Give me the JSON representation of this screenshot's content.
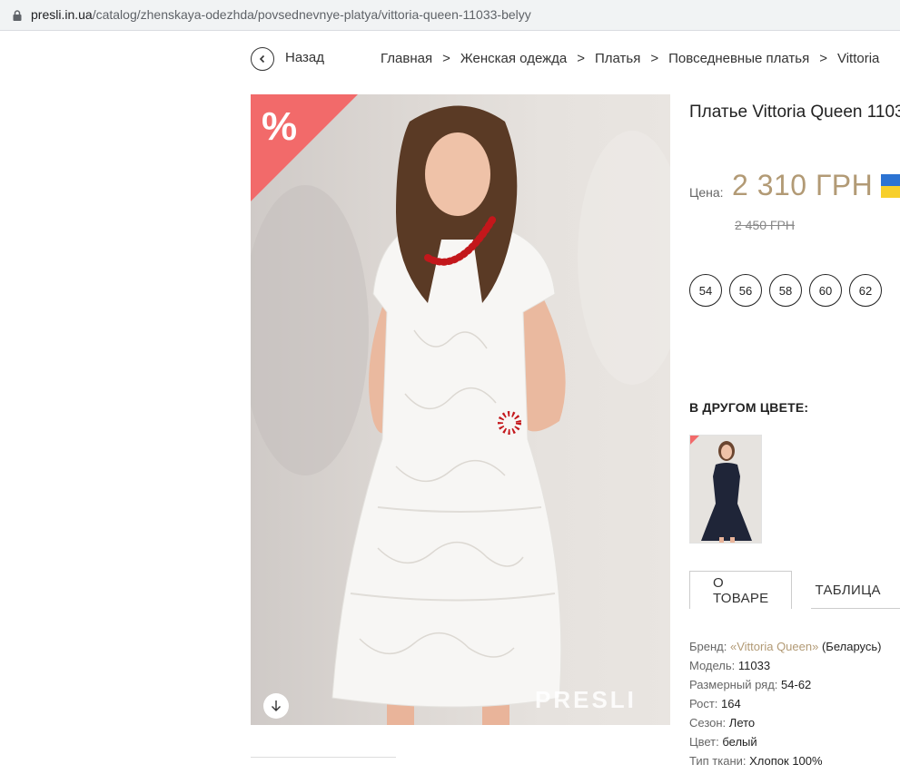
{
  "browser": {
    "url_host": "presli.in.ua",
    "url_path": "/catalog/zhenskaya-odezhda/povsednevnye-platya/vittoria-queen-11033-belyy"
  },
  "nav": {
    "back_label": "Назад",
    "breadcrumb": [
      "Главная",
      "Женская одежда",
      "Платья",
      "Повседневные платья",
      "Vittoria"
    ],
    "separator": ">"
  },
  "image": {
    "sale_symbol": "%",
    "watermark": "PRESLI"
  },
  "product": {
    "title": "Платье Vittoria Queen 1103",
    "price_label": "Цена:",
    "price": "2 310 ГРН",
    "old_price": "2 450 ГРН",
    "sizes": [
      "54",
      "56",
      "58",
      "60",
      "62"
    ],
    "other_color_label": "В ДРУГОМ ЦВЕТЕ:"
  },
  "tabs": [
    "О ТОВАРЕ",
    "ТАБЛИЦА"
  ],
  "specs": {
    "brand_key": "Бренд:",
    "brand_value": "«Vittoria Queen»",
    "brand_country": "(Беларусь)",
    "model_key": "Модель:",
    "model_value": "11033",
    "sizes_key": "Размерный ряд:",
    "sizes_value": "54-62",
    "height_key": "Рост:",
    "height_value": "164",
    "season_key": "Сезон:",
    "season_value": "Лето",
    "color_key": "Цвет:",
    "color_value": "белый",
    "fabric_key": "Тип ткани:",
    "fabric_value": "Хлопок 100%"
  },
  "colors": {
    "accent": "#b29a75",
    "sale": "#f26a6a"
  },
  "icons": [
    "lock-icon",
    "chevron-left-icon",
    "arrow-down-icon",
    "ukraine-flag-icon"
  ]
}
